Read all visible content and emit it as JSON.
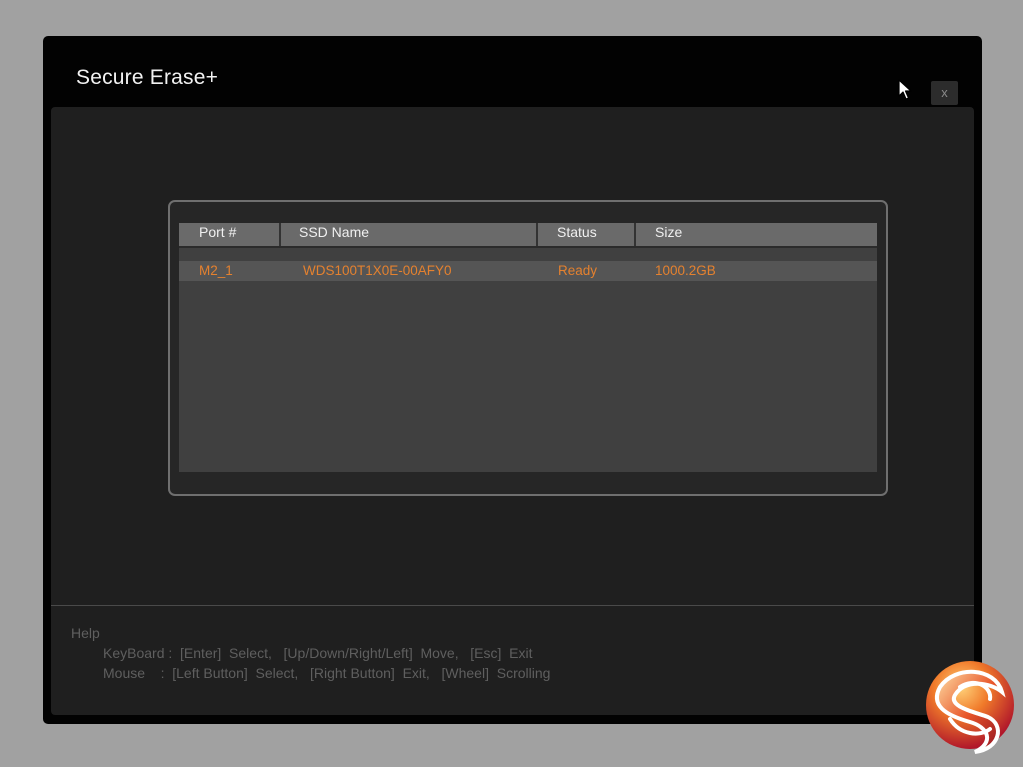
{
  "window": {
    "title": "Secure Erase+",
    "close_label": "x"
  },
  "ssd_table": {
    "columns": [
      "Port #",
      "SSD Name",
      "Status",
      "Size"
    ],
    "rows": [
      {
        "port": "M2_1",
        "name": "WDS100T1X0E-00AFY0",
        "status": "Ready",
        "size": "1000.2GB"
      }
    ]
  },
  "help": {
    "title": "Help",
    "keyboard": "KeyBoard :  [Enter]  Select,   [Up/Down/Right/Left]  Move,   [Esc]  Exit",
    "mouse": "Mouse    :  [Left Button]  Select,   [Right Button]  Exit,   [Wheel]  Scrolling"
  },
  "colors": {
    "background": "#a1a1a1",
    "window": "#020202",
    "panel": "#1f1f1f",
    "row_text": "#e4812f",
    "header_bg": "#6a6a6a"
  },
  "icons": {
    "cursor": "mouse-pointer-icon",
    "logo": "kitguru-logo-icon"
  }
}
